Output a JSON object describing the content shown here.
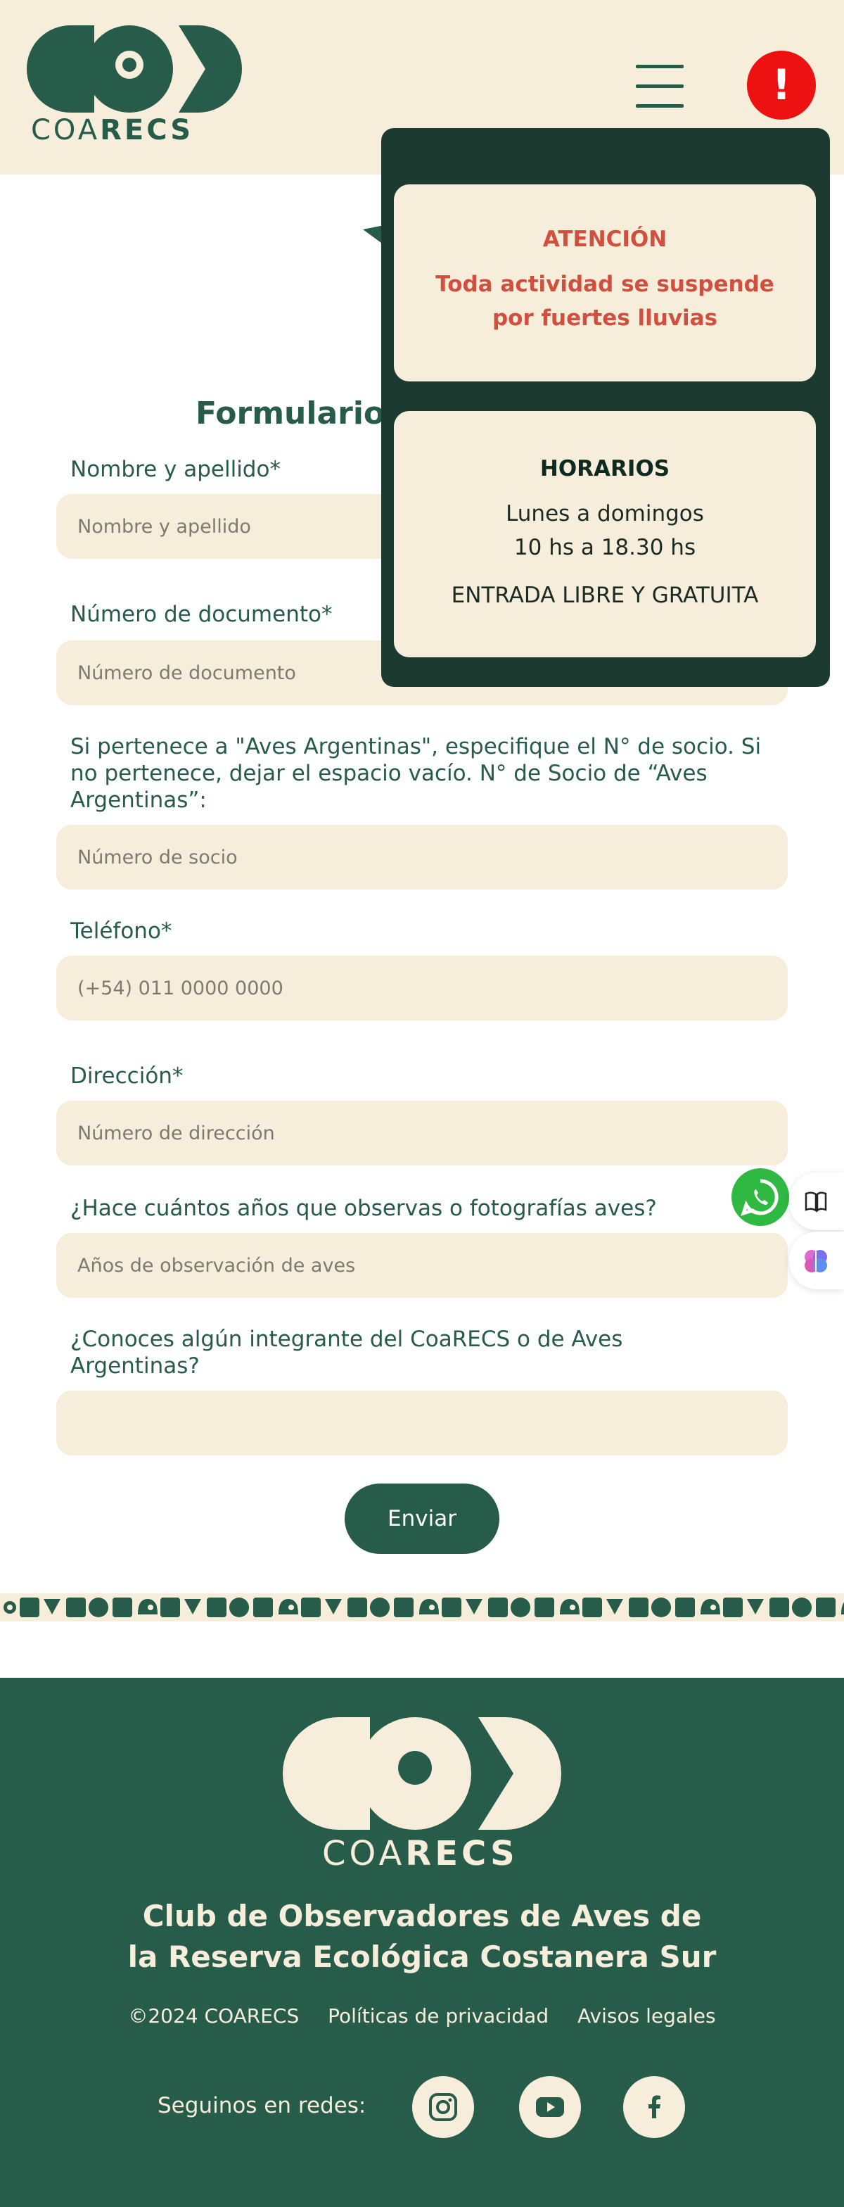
{
  "brand": {
    "logo_text_light": "COA",
    "logo_text_bold": "RECS"
  },
  "header": {
    "menu_label": "Menú",
    "alert_symbol": "!"
  },
  "form": {
    "title_visible": "Formulario",
    "fields": [
      {
        "label": "Nombre y apellido*",
        "placeholder": "Nombre y apellido",
        "value": ""
      },
      {
        "label": "Número de documento*",
        "placeholder": "Número de documento",
        "value": ""
      },
      {
        "label": "Si pertenece a \"Aves Argentinas\", especifique el N° de socio. Si no pertenece, dejar el espacio vacío. N° de Socio de “Aves Argentinas”:",
        "placeholder": "Número de socio",
        "value": ""
      },
      {
        "label": "Teléfono*",
        "placeholder": "(+54) 011 0000 0000",
        "value": ""
      },
      {
        "label": "Dirección*",
        "placeholder": "Número de dirección",
        "value": ""
      },
      {
        "label": "¿Hace cuántos años que observas o fotografías aves?",
        "placeholder": "Años de observación de aves",
        "value": ""
      },
      {
        "label": "¿Conoces algún integrante del CoaRECS o de Aves Argentinas?",
        "placeholder": "",
        "value": ""
      }
    ],
    "submit_label": "Enviar"
  },
  "popup": {
    "alert": {
      "title": "ATENCIÓN",
      "message": "Toda actividad se suspende por fuertes lluvias"
    },
    "hours": {
      "title": "HORARIOS",
      "days": "Lunes a domingos",
      "time": "10 hs a 18.30 hs",
      "entry": "ENTRADA LIBRE Y GRATUITA"
    }
  },
  "footer": {
    "title_line1": "Club de Observadores de Aves de",
    "title_line2": "la Reserva Ecológica Costanera Sur",
    "copyright": "©2024 COARECS",
    "privacy": "Políticas de privacidad",
    "legal": "Avisos legales",
    "social_label": "Seguinos en redes:",
    "social_icons": [
      "instagram-icon",
      "youtube-icon",
      "facebook-icon"
    ]
  },
  "colors": {
    "primary": "#275b4a",
    "cream": "#f6eedb",
    "alert_red": "#ee1111",
    "popup_bg": "#1c3a30",
    "warning_text": "#d04f3f",
    "whatsapp": "#2fb942"
  }
}
